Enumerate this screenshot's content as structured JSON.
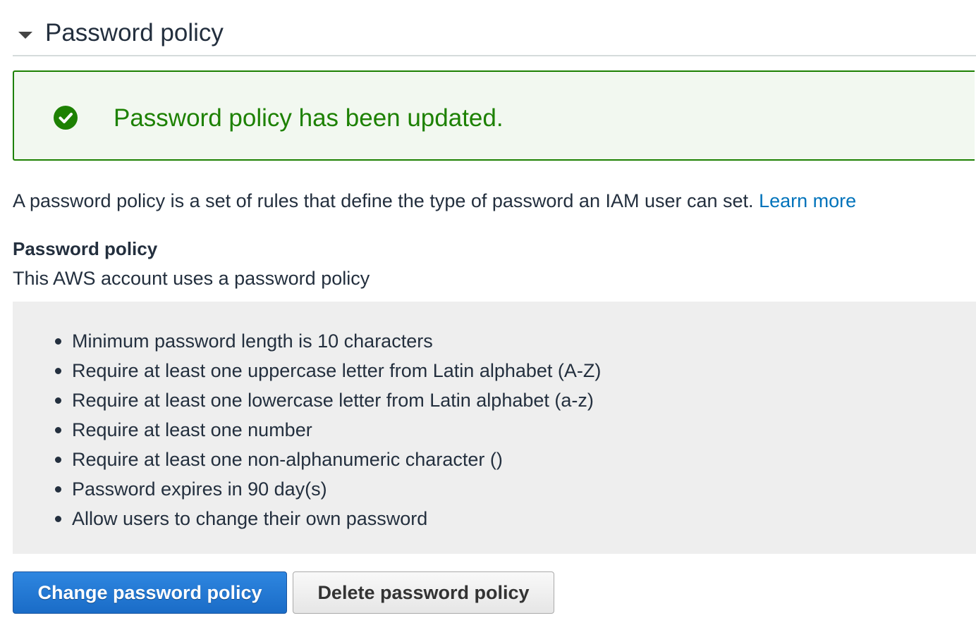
{
  "section": {
    "title": "Password policy",
    "expanded": true
  },
  "alert": {
    "type": "success",
    "message": "Password policy has been updated.",
    "icon": "check-circle-icon",
    "color": "#1d8102"
  },
  "description": {
    "text": "A password policy is a set of rules that define the type of password an IAM user can set.",
    "link_label": "Learn more",
    "link_color": "#0073bb"
  },
  "policy": {
    "heading": "Password policy",
    "status": "This AWS account uses a password policy",
    "rules": [
      "Minimum password length is 10 characters",
      "Require at least one uppercase letter from Latin alphabet (A-Z)",
      "Require at least one lowercase letter from Latin alphabet (a-z)",
      "Require at least one number",
      "Require at least one non-alphanumeric character ()",
      "Password expires in 90 day(s)",
      "Allow users to change their own password"
    ]
  },
  "buttons": {
    "change_label": "Change password policy",
    "delete_label": "Delete password policy",
    "primary_color": "#1a6cc7"
  }
}
